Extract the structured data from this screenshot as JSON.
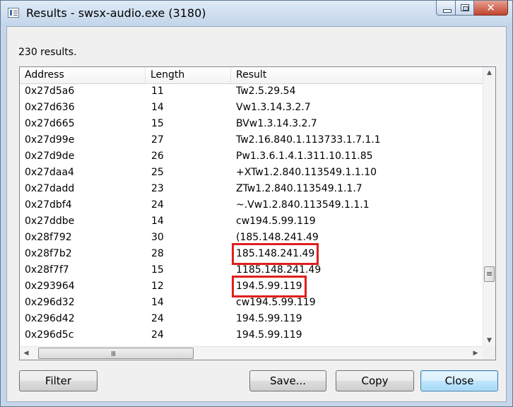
{
  "window": {
    "title": "Results - swsx-audio.exe (3180)",
    "caption_buttons": {
      "minimize": "minimize-icon",
      "maximize": "maximize-icon",
      "close": "✕"
    }
  },
  "summary": {
    "count_text": "230 results."
  },
  "table": {
    "columns": {
      "address": "Address",
      "length": "Length",
      "result": "Result"
    },
    "rows": [
      {
        "address": "0x27d5a6",
        "length": "11",
        "result": "Tw2.5.29.54"
      },
      {
        "address": "0x27d636",
        "length": "14",
        "result": "Vw1.3.14.3.2.7"
      },
      {
        "address": "0x27d665",
        "length": "15",
        "result": "BVw1.3.14.3.2.7"
      },
      {
        "address": "0x27d99e",
        "length": "27",
        "result": "Tw2.16.840.1.113733.1.7.1.1"
      },
      {
        "address": "0x27d9de",
        "length": "26",
        "result": "Pw1.3.6.1.4.1.311.10.11.85"
      },
      {
        "address": "0x27daa4",
        "length": "25",
        "result": "+XTw1.2.840.113549.1.1.10"
      },
      {
        "address": "0x27dadd",
        "length": "23",
        "result": "ZTw1.2.840.113549.1.1.7"
      },
      {
        "address": "0x27dbf4",
        "length": "24",
        "result": "~.Vw1.2.840.113549.1.1.1"
      },
      {
        "address": "0x27ddbe",
        "length": "14",
        "result": "cw194.5.99.119"
      },
      {
        "address": "0x28f792",
        "length": "30",
        "result": "(185.148.241.49"
      },
      {
        "address": "0x28f7b2",
        "length": "28",
        "result": "185.148.241.49"
      },
      {
        "address": "0x28f7f7",
        "length": "15",
        "result": "1185.148.241.49"
      },
      {
        "address": "0x293964",
        "length": "12",
        "result": "194.5.99.119"
      },
      {
        "address": "0x296d32",
        "length": "14",
        "result": "cw194.5.99.119"
      },
      {
        "address": "0x296d42",
        "length": "24",
        "result": "194.5.99.119"
      },
      {
        "address": "0x296d5c",
        "length": "24",
        "result": "194.5.99.119"
      }
    ],
    "highlight_color": "#e01e1e"
  },
  "buttons": {
    "filter": "Filter",
    "save": "Save...",
    "copy": "Copy",
    "close": "Close"
  }
}
